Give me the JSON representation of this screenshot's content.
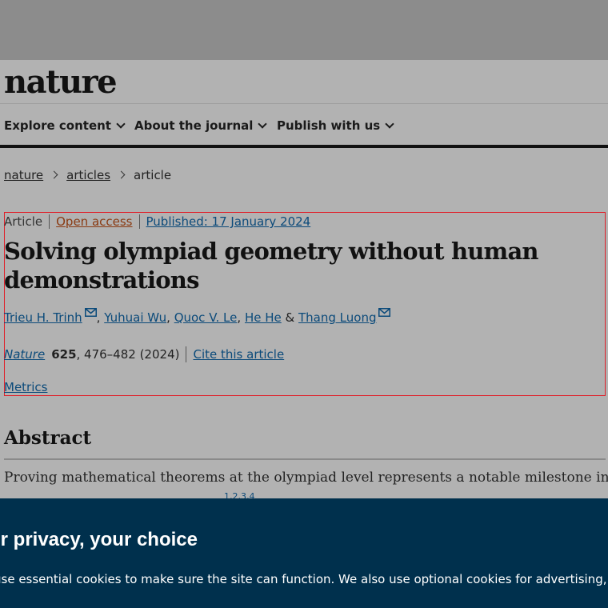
{
  "header": {
    "logo": "nature"
  },
  "nav": {
    "items": [
      {
        "label": "Explore content"
      },
      {
        "label": "About the journal"
      },
      {
        "label": "Publish with us"
      }
    ]
  },
  "breadcrumb": {
    "items": [
      "nature",
      "articles",
      "article"
    ]
  },
  "article": {
    "type": "Article",
    "access": "Open access",
    "published": "Published: 17 January 2024",
    "title": "Solving olympiad geometry without human demonstrations",
    "authors": [
      "Trieu H. Trinh",
      "Yuhuai Wu",
      "Quoc V. Le",
      "He He",
      "Thang Luong"
    ],
    "author_sep": ",",
    "author_and": "&",
    "journal": "Nature",
    "volume": "625",
    "pages": ", 476–482 (2024)",
    "cite_label": "Cite this article",
    "metrics_label": "Metrics"
  },
  "abstract": {
    "heading": "Abstract",
    "first_line": "Proving mathematical theorems at the olympiad level represents a notable milestone in",
    "partial_refs": "1,2,3,4"
  },
  "cookie_banner": {
    "title": "ur privacy, your choice",
    "text": "use essential cookies to make sure the site can function. We also use optional cookies for advertising, person"
  },
  "colors": {
    "overlay_bg": "#b2b2b2",
    "link": "#0b4a7a",
    "open_access": "#8a3a12",
    "cookie_bg": "#00304d",
    "highlight": "#e0202a"
  }
}
